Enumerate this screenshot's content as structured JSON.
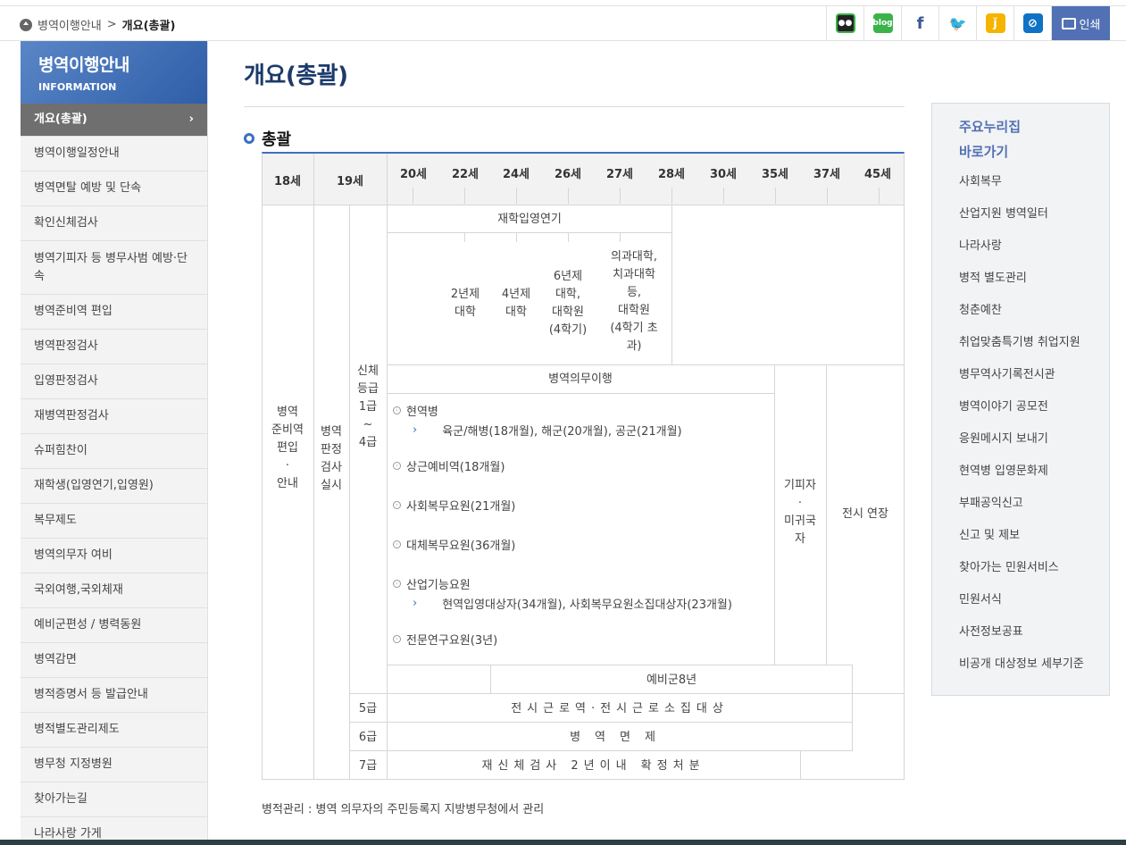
{
  "breadcrumb": {
    "parent": "병역이행안내",
    "separator": ">",
    "current": "개요(총괄)"
  },
  "share": {
    "print_label": "인쇄",
    "icons": [
      "band-icon",
      "blog-icon",
      "facebook-icon",
      "twitter-icon",
      "kakaostory-icon",
      "link-icon"
    ]
  },
  "sidebar": {
    "title": "병역이행안내",
    "subtitle": "INFORMATION",
    "items": [
      {
        "label": "개요(총괄)",
        "active": true
      },
      {
        "label": "병역이행일정안내"
      },
      {
        "label": "병역면탈 예방 및 단속"
      },
      {
        "label": "확인신체검사"
      },
      {
        "label": "병역기피자 등 병무사범 예방·단속"
      },
      {
        "label": "병역준비역 편입"
      },
      {
        "label": "병역판정검사"
      },
      {
        "label": "입영판정검사"
      },
      {
        "label": "재병역판정검사"
      },
      {
        "label": "슈퍼힘찬이"
      },
      {
        "label": "재학생(입영연기,입영원)"
      },
      {
        "label": "복무제도"
      },
      {
        "label": "병역의무자 여비"
      },
      {
        "label": "국외여행,국외체재"
      },
      {
        "label": "예비군편성 / 병력동원"
      },
      {
        "label": "병역감면"
      },
      {
        "label": "병적증명서 등 발급안내"
      },
      {
        "label": "병적별도관리제도"
      },
      {
        "label": "병무청 지정병원"
      },
      {
        "label": "찾아가는길"
      },
      {
        "label": "나라사랑 가게"
      }
    ]
  },
  "main": {
    "title": "개요(총괄)",
    "section": "총괄",
    "ages": [
      "18세",
      "19세",
      "20세",
      "22세",
      "24세",
      "26세",
      "27세",
      "28세",
      "30세",
      "35세",
      "37세",
      "45세"
    ],
    "col_prep": "병역\n준비역\n편입\n·\n안내",
    "col_exam": "병역\n판정\n검사\n실시",
    "col_grade": "신체\n등급\n1급\n~\n4급",
    "defer_title": "재학입영연기",
    "defer_items": [
      "2년제\n대학",
      "4년제\n대학",
      "6년제\n대학,\n대학원\n(4학기)",
      "의과대학,\n치과대학\n등,\n대학원\n(4학기 초\n과)"
    ],
    "duty_title": "병역의무이행",
    "services": [
      {
        "name": "현역병",
        "sub": "육군/해병(18개월), 해군(20개월), 공군(21개월)"
      },
      {
        "name": "상근예비역(18개월)"
      },
      {
        "name": "사회복무요원(21개월)"
      },
      {
        "name": "대체복무요원(36개월)"
      },
      {
        "name": "산업기능요원",
        "sub": "현역입영대상자(34개월), 사회복무요원소집대상자(23개월)"
      },
      {
        "name": "전문연구요원(3년)"
      }
    ],
    "evader": "기피자\n·\n미귀국\n자",
    "wartime_ext": "전시 연장",
    "reserve": "예비군8년",
    "grade5": "5급",
    "grade5_text": "전시근로역·전시근로소집대상",
    "grade6": "6급",
    "grade6_text": "병역면제",
    "grade7": "7급",
    "grade7_text": "재신체검사 2년이내 확정처분",
    "note": "병적관리 : 병역 의무자의 주민등록지 지방병무청에서 관리"
  },
  "quick": {
    "title1": "주요누리집",
    "title2": "바로가기",
    "links": [
      "사회복무",
      "산업지원 병역일터",
      "나라사랑",
      "병적 별도관리",
      "청춘예찬",
      "취업맞춤특기병 취업지원",
      "병무역사기록전시관",
      "병역이야기 공모전",
      "응원메시지 보내기",
      "현역병 입영문화제",
      "부패공익신고",
      "신고 및 제보",
      "찾아가는 민원서비스",
      "민원서식",
      "사전정보공표",
      "비공개 대상정보 세부기준"
    ]
  }
}
